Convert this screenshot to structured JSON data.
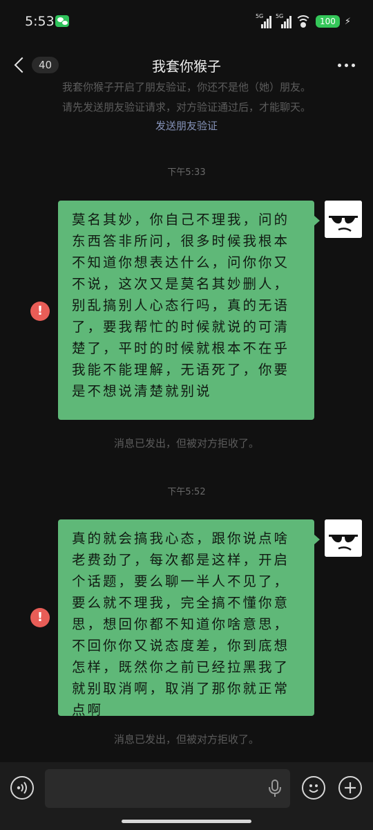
{
  "status_bar": {
    "time": "5:53",
    "signal1_label": "5G",
    "signal2_label": "5G",
    "battery": "100"
  },
  "navbar": {
    "unread_count": "40",
    "title": "我套你猴子"
  },
  "system": {
    "notice_line1": "我套你猴子开启了朋友验证，你还不是他（她）朋友。",
    "notice_line2": "请先发送朋友验证请求，对方验证通过后，才能聊天。",
    "send_request_link": "发送朋友验证"
  },
  "messages": [
    {
      "time": "下午5:33",
      "text": "莫名其妙，你自己不理我，问的东西答非所问，很多时候我根本不知道你想表达什么，问你你又不说，这次又是莫名其妙删人，别乱搞别人心态行吗，真的无语了，要我帮忙的时候就说的可清楚了，平时的时候就根本不在乎我能不能理解，无语死了，你要是不想说清楚就别说",
      "status": "消息已发出，但被对方拒收了。"
    },
    {
      "time": "下午5:52",
      "text": "真的就会搞我心态，跟你说点啥老费劲了，每次都是这样，开启个话题，要么聊一半人不见了，要么就不理我，完全搞不懂你意思，想回你都不知道你啥意思，不回你你又说态度差，你到底想怎样，既然你之前已经拉黑我了就别取消啊，取消了那你就正常点啊",
      "status": "消息已发出，但被对方拒收了。"
    }
  ],
  "colors": {
    "background": "#111111",
    "bubble": "#5fb878",
    "error": "#e85d57",
    "battery": "#34c759"
  },
  "icons": [
    "wechat-icon",
    "back-chevron-icon",
    "more-icon",
    "error-icon",
    "voice-icon",
    "microphone-icon",
    "emoji-icon",
    "plus-icon"
  ]
}
